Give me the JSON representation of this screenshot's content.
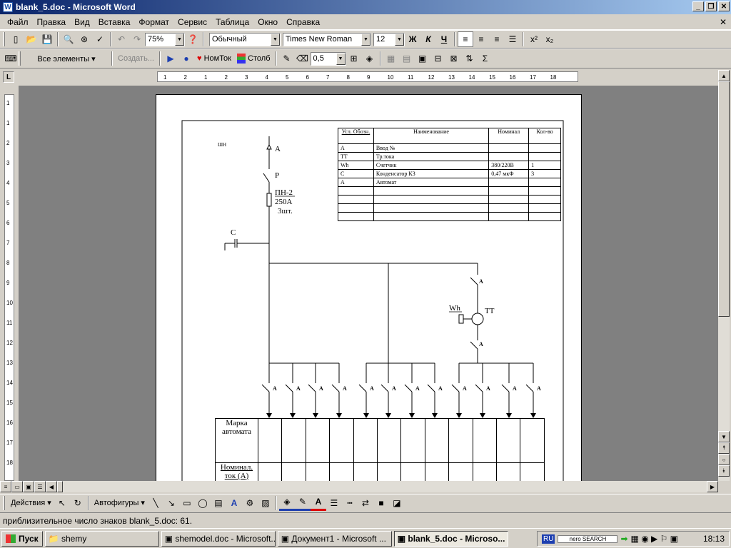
{
  "window": {
    "title": "blank_5.doc - Microsoft Word"
  },
  "menu": [
    "Файл",
    "Правка",
    "Вид",
    "Вставка",
    "Формат",
    "Сервис",
    "Таблица",
    "Окно",
    "Справка"
  ],
  "toolbar": {
    "zoom": "75%",
    "style": "Обычный",
    "font": "Times New Roman",
    "size": "12",
    "bold": "Ж",
    "italic": "К",
    "underline": "Ч"
  },
  "toolbar2": {
    "all_elements": "Все элементы ▾",
    "create": "Создать...",
    "nomtok": "НомТок",
    "stolb": "Столб",
    "line_width": "0,5"
  },
  "ruler": {
    "h": [
      "1",
      "2",
      "1",
      "2",
      "3",
      "4",
      "5",
      "6",
      "7",
      "8",
      "9",
      "10",
      "11",
      "12",
      "13",
      "14",
      "15",
      "16",
      "17",
      "18"
    ],
    "v": [
      "1",
      "1",
      "2",
      "3",
      "4",
      "5",
      "6",
      "7",
      "8",
      "9",
      "10",
      "11",
      "12",
      "13",
      "14",
      "15",
      "16",
      "17",
      "18"
    ]
  },
  "diagram": {
    "label_shn": "ШН",
    "label_a_top": "А",
    "label_p": "Р",
    "fuse_label": [
      "ПН-2",
      "250А",
      "3шт."
    ],
    "label_c": "С",
    "label_wh": "Wh",
    "label_tt": "ТТ",
    "label_a": "А",
    "legend_headers": [
      "Усл. Обозн.",
      "Наименование",
      "Номинал",
      "Кол-во"
    ],
    "legend_rows": [
      [
        "А",
        "Ввод   №",
        "",
        ""
      ],
      [
        "ТТ",
        "Тр.тока",
        "",
        ""
      ],
      [
        "Wh",
        "Счетчик",
        "380/220В",
        "1"
      ],
      [
        "С",
        "Конденсатор  КЗ",
        "0,47 мкФ",
        "3"
      ],
      [
        "А",
        "Автомат",
        "",
        ""
      ],
      [
        "",
        "",
        "",
        ""
      ],
      [
        "",
        "",
        "",
        ""
      ],
      [
        "",
        "",
        "",
        ""
      ],
      [
        "",
        "",
        "",
        ""
      ]
    ],
    "bottom_labels": [
      "Марка автомата",
      "Номинал. ток (А)"
    ]
  },
  "drawing": {
    "actions": "Действия ▾",
    "autoshapes": "Автофигуры ▾"
  },
  "status": {
    "text": "приблизительное число знаков blank_5.doc: 61."
  },
  "taskbar": {
    "start": "Пуск",
    "items": [
      "shemy",
      "shemodel.doc - Microsoft...",
      "Документ1 - Microsoft ...",
      "blank_5.doc - Microso..."
    ],
    "lang": "RU",
    "search": "nero SEARCH",
    "clock": "18:13"
  }
}
